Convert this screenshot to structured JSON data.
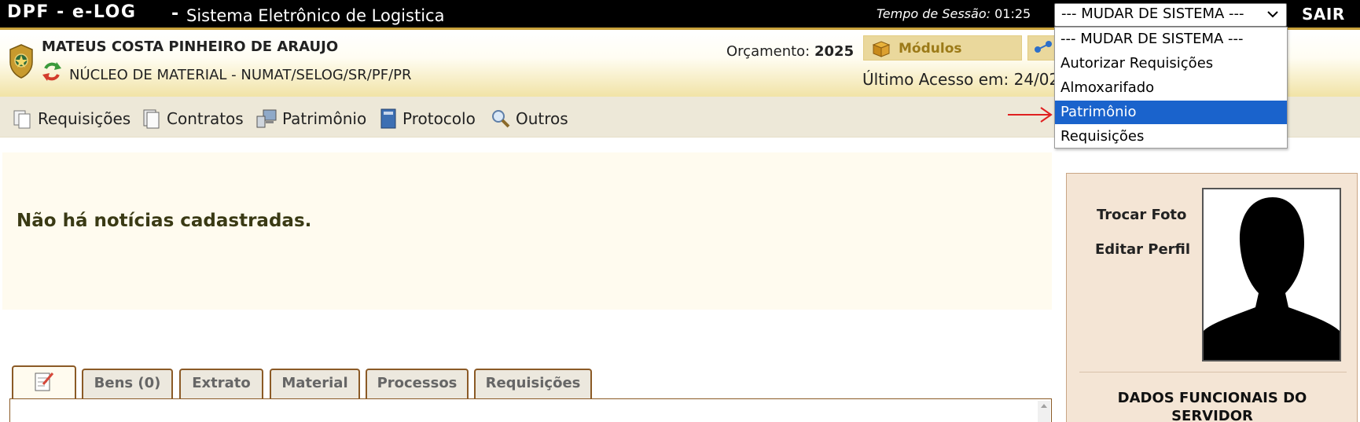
{
  "topbar": {
    "app_title": "DPF - e-LOG",
    "separator": "-",
    "app_subtitle": "Sistema Eletrônico de Logistica",
    "session_label": "Tempo de Sessão:",
    "session_time": "01:25",
    "system_select_value": "--- MUDAR DE SISTEMA ---",
    "logout_label": "SAIR"
  },
  "system_dropdown": {
    "options": [
      "--- MUDAR DE SISTEMA ---",
      "Autorizar Requisições",
      "Almoxarifado",
      "Patrimônio",
      "Requisições"
    ],
    "highlighted": "Patrimônio"
  },
  "header": {
    "user_name": "MATEUS COSTA PINHEIRO DE ARAUJO",
    "unit_name": "NÚCLEO DE MATERIAL - NUMAT/SELOG/SR/PF/PR",
    "budget_label": "Orçamento:",
    "budget_year": "2025",
    "modules_label": "Módulos",
    "last_access": "Último Acesso em: 24/02"
  },
  "nav": {
    "items": [
      {
        "label": "Requisições",
        "icon": "pages-icon"
      },
      {
        "label": "Contratos",
        "icon": "document-icon"
      },
      {
        "label": "Patrimônio",
        "icon": "computer-icon"
      },
      {
        "label": "Protocolo",
        "icon": "book-icon"
      },
      {
        "label": "Outros",
        "icon": "magnifier-icon"
      }
    ]
  },
  "news": {
    "message": "Não há notícias cadastradas."
  },
  "tabs": {
    "items": [
      "Bens (0)",
      "Extrato",
      "Material",
      "Processos",
      "Requisições"
    ]
  },
  "profile": {
    "change_photo": "Trocar Foto",
    "edit_profile": "Editar Perfil",
    "section_title": "DADOS FUNCIONAIS DO SERVIDOR"
  },
  "colors": {
    "topbar_bg": "#000000",
    "accent_gold": "#c8a13a",
    "selected_option": "#1a63cc",
    "tab_border": "#8b5a26"
  }
}
